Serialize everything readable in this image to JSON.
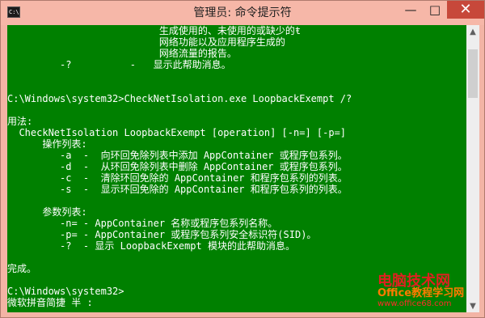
{
  "window": {
    "title": "管理员: 命令提示符",
    "app_icon_text": "C:\\",
    "controls": {
      "minimize": "—",
      "maximize": "□",
      "close": "✕"
    }
  },
  "console": {
    "lines": [
      "                          生成使用的、未使用的或缺少的ŧ",
      "                          网络功能以及应用程序生成的",
      "                          网络流量的报告。",
      "         -?          -   显示此帮助消息。",
      "",
      "",
      "C:\\Windows\\system32>CheckNetIsolation.exe LoopbackExempt /?",
      "",
      "用法:",
      "  CheckNetIsolation LoopbackExempt [operation] [-n=] [-p=]",
      "      操作列表:",
      "         -a  -  向环回免除列表中添加 AppContainer 或程序包系列。",
      "         -d  -  从环回免除列表中删除 AppContainer 或程序包系列。",
      "         -c  -  清除环回免除的 AppContainer 和程序包系列的列表。",
      "         -s  -  显示环回免除的 AppContainer 和程序包系列的列表。",
      "",
      "      参数列表:",
      "         -n= - AppContainer 名称或程序包系列名称。",
      "         -p= - AppContainer 或程序包系列安全标识符(SID)。",
      "         -?  - 显示 LoopbackExempt 模块的此帮助消息。",
      "",
      "完成。",
      "",
      "C:\\Windows\\system32>",
      "微软拼音简捷 半 :"
    ]
  },
  "scrollbar": {
    "up": "▲",
    "down": "▼"
  },
  "watermark": {
    "line1": "电脑技术网",
    "line2": "Office教程学习网",
    "url": "www.office68.com"
  }
}
